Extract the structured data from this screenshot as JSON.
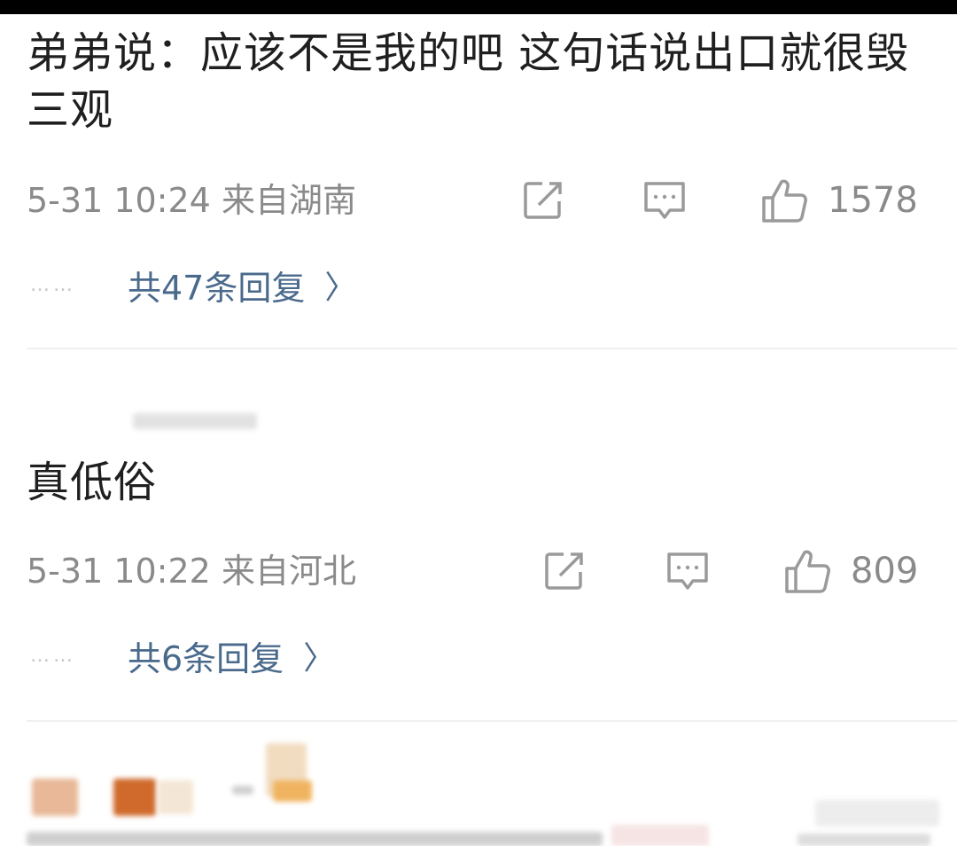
{
  "comments": [
    {
      "text": "弟弟说：应该不是我的吧 这句话说出口就很毁三观",
      "time": "5-31 10:24",
      "location": "来自湖南",
      "likes": "1578",
      "replies": "共47条回复",
      "reply_dots": "……"
    },
    {
      "text": "真低俗",
      "time": "5-31 10:22",
      "location": "来自河北",
      "likes": "809",
      "replies": "共6条回复",
      "reply_dots": "……"
    }
  ],
  "icons": {
    "share": "share-icon",
    "comment": "comment-icon",
    "like": "thumbs-up-icon",
    "chevron": "chevron-right-icon"
  },
  "chevron_glyph": "〉",
  "colors": {
    "link": "#4a6a8c",
    "meta": "#8a8a8a",
    "divider": "#f0f0f0"
  }
}
